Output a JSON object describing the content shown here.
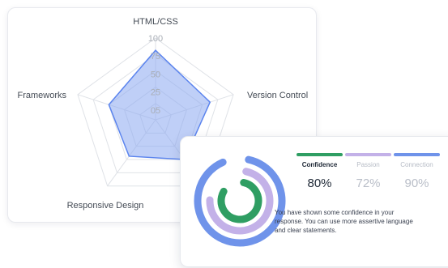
{
  "radar": {
    "axes": [
      "HTML/CSS",
      "Version Control",
      "",
      "Responsive Design",
      "Frameworks"
    ],
    "ticks": [
      "100",
      "75",
      "50",
      "25",
      "05"
    ],
    "fill_color": "#8aa8f0",
    "stroke_color": "#5b84ee"
  },
  "chart_data": {
    "type": "radar",
    "categories": [
      "HTML/CSS",
      "Version Control",
      "",
      "Responsive Design",
      "Frameworks"
    ],
    "series": [
      {
        "values": [
          85,
          70,
          60,
          55,
          60
        ]
      }
    ],
    "ylim": [
      0,
      100
    ]
  },
  "result": {
    "metrics": [
      {
        "name": "Confidence",
        "value": "80%",
        "color": "#2f9e63",
        "active": true
      },
      {
        "name": "Passion",
        "value": "72%",
        "color": "#c3b1e8",
        "active": false
      },
      {
        "name": "Connection",
        "value": "90%",
        "color": "#6f93ea",
        "active": false
      }
    ],
    "rings": [
      {
        "name": "Connection",
        "fraction": 0.9,
        "color": "#6f93ea"
      },
      {
        "name": "Passion",
        "fraction": 0.72,
        "color": "#c3b1e8"
      },
      {
        "name": "Confidence",
        "fraction": 0.8,
        "color": "#2f9e63"
      }
    ],
    "feedback": "You have shown some confidence in your response. You can use more assertive language and clear statements."
  }
}
